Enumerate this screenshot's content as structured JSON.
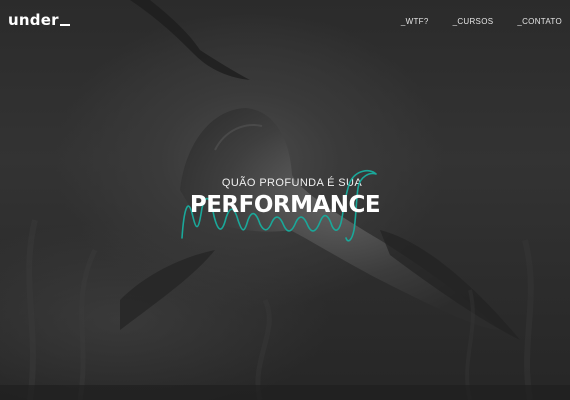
{
  "brand": {
    "logo_text": "under"
  },
  "nav": {
    "items": [
      {
        "label": "_WTF?"
      },
      {
        "label": "_CURSOS"
      },
      {
        "label": "_CONTATO"
      }
    ]
  },
  "hero": {
    "subtitle": "QUÃO PROFUNDA É SUA",
    "title": "PERFORMANCE",
    "scribble_icon": "wave-scribble-icon",
    "background_icon": "underwater-fish-photo"
  },
  "colors": {
    "accent": "#1aa89a",
    "text": "#ffffff",
    "background": "#2e2e2e"
  }
}
